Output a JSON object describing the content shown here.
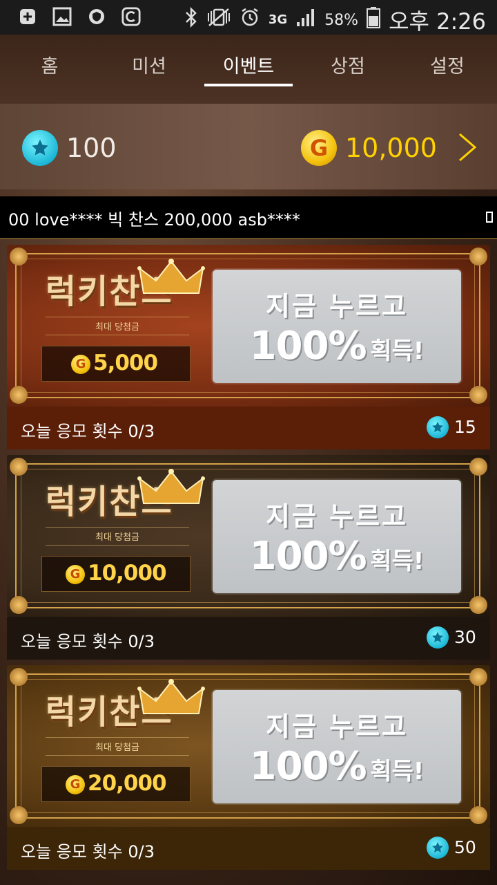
{
  "status_bar": {
    "battery_percent": "58%",
    "network": "3G",
    "time": "오후 2:26"
  },
  "tabs": [
    {
      "label": "홈",
      "active": false
    },
    {
      "label": "미션",
      "active": false
    },
    {
      "label": "이벤트",
      "active": true
    },
    {
      "label": "상점",
      "active": false
    },
    {
      "label": "설정",
      "active": false
    }
  ],
  "currency": {
    "gems": "100",
    "gold_symbol": "G",
    "gold": "10,000"
  },
  "ticker": {
    "text": "00 love****  빅 찬스 200,000 asb****"
  },
  "events": [
    {
      "title": "럭키찬스",
      "subtitle": "최대 당첨금",
      "prize": "5,000",
      "cta_line1": "지금 누르고",
      "cta_big": "100%",
      "cta_small": "획득!",
      "entries": "오늘 응모 횟수 0/3",
      "cost": "15",
      "theme": "#7a2e12"
    },
    {
      "title": "럭키찬스",
      "subtitle": "최대 당첨금",
      "prize": "10,000",
      "cta_line1": "지금 누르고",
      "cta_big": "100%",
      "cta_small": "획득!",
      "entries": "오늘 응모 횟수 0/3",
      "cost": "30",
      "theme": "#3a2a1a"
    },
    {
      "title": "럭키찬스",
      "subtitle": "최대 당첨금",
      "prize": "20,000",
      "cta_line1": "지금 누르고",
      "cta_big": "100%",
      "cta_small": "획득!",
      "entries": "오늘 응모 횟수 0/3",
      "cost": "50",
      "theme": "#5a3a12"
    }
  ],
  "colors": {
    "gold_text": "#ffd200",
    "gem_blue": "#1cb7d6"
  }
}
